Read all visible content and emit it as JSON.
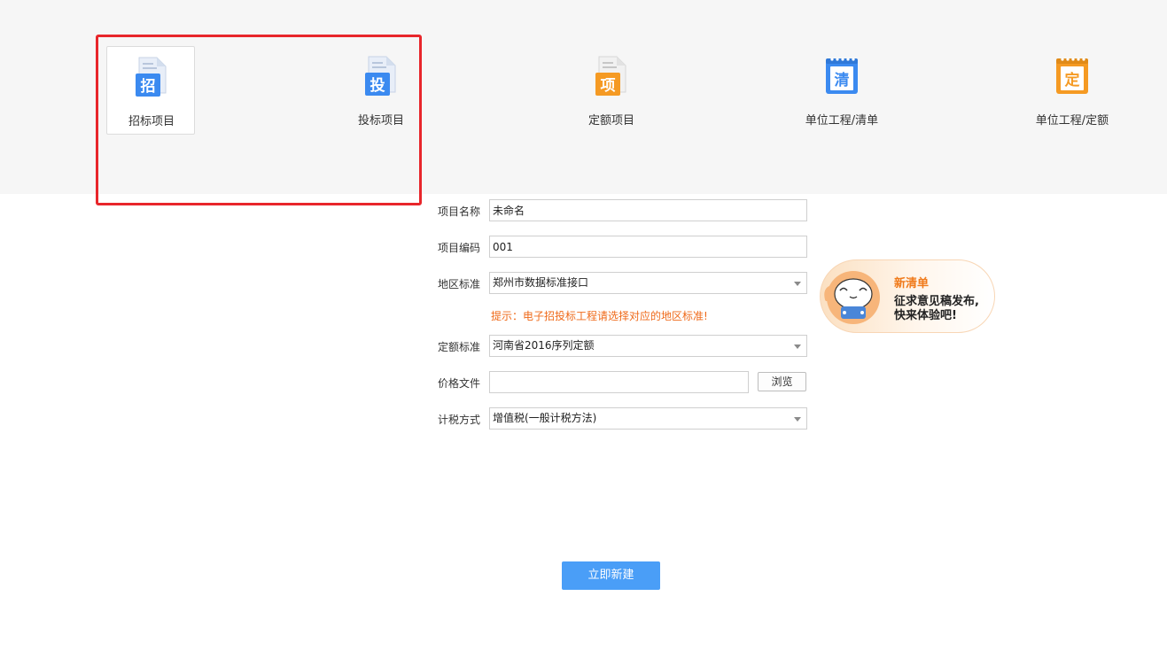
{
  "project_types": [
    {
      "label": "招标项目",
      "glyph": "招",
      "color": "#3b8af0",
      "icon": "bid-invitation-icon",
      "selected": true
    },
    {
      "label": "投标项目",
      "glyph": "投",
      "color": "#3b8af0",
      "icon": "bid-submission-icon",
      "selected": false
    },
    {
      "label": "定额项目",
      "glyph": "项",
      "color": "#f59a23",
      "icon": "quota-project-icon",
      "selected": false
    },
    {
      "label": "单位工程/清单",
      "glyph": "清",
      "color": "#3b8af0",
      "icon": "unit-bill-icon",
      "selected": false
    },
    {
      "label": "单位工程/定额",
      "glyph": "定",
      "color": "#f59a23",
      "icon": "unit-quota-icon",
      "selected": false
    }
  ],
  "form": {
    "project_name": {
      "label": "项目名称",
      "value": "未命名"
    },
    "project_code": {
      "label": "项目编码",
      "value": "001"
    },
    "region_standard": {
      "label": "地区标准",
      "value": "郑州市数据标准接口"
    },
    "hint": "提示：电子招投标工程请选择对应的地区标准!",
    "quota_standard": {
      "label": "定额标准",
      "value": "河南省2016序列定额"
    },
    "price_file": {
      "label": "价格文件",
      "value": "",
      "browse_label": "浏览"
    },
    "tax_method": {
      "label": "计税方式",
      "value": "增值税(一般计税方法)"
    }
  },
  "promo": {
    "title": "新清单",
    "line1": "征求意见稿发布,",
    "line2": "快来体验吧!",
    "icon": "mascot-icon"
  },
  "actions": {
    "create_label": "立即新建"
  },
  "colors": {
    "accent_blue": "#4a9ef7",
    "hint_orange": "#ef6a1a",
    "highlight_red": "#e8262b"
  }
}
